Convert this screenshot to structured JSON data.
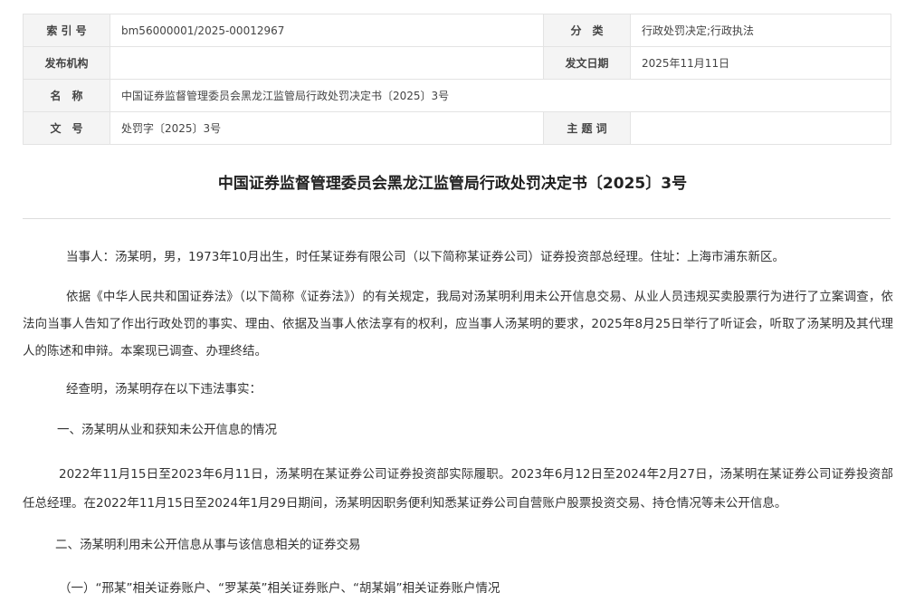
{
  "meta": {
    "index_label": "索 引 号",
    "index_value": "bm56000001/2025-00012967",
    "category_label": "分　类",
    "category_value": "行政处罚决定;行政执法",
    "publisher_label": "发布机构",
    "publisher_value": "",
    "date_label": "发文日期",
    "date_value": "2025年11月11日",
    "name_label": "名　称",
    "name_value": "中国证券监督管理委员会黑龙江监管局行政处罚决定书〔2025〕3号",
    "docno_label": "文　号",
    "docno_value": "处罚字〔2025〕3号",
    "keywords_label": "主 题 词",
    "keywords_value": ""
  },
  "document": {
    "title": "中国证券监督管理委员会黑龙江监管局行政处罚决定书〔2025〕3号",
    "p1": "当事人：汤某明，男，1973年10月出生，时任某证券有限公司（以下简称某证券公司）证券投资部总经理。住址：上海市浦东新区。",
    "p2": "依据《中华人民共和国证券法》（以下简称《证券法》）的有关规定，我局对汤某明利用未公开信息交易、从业人员违规买卖股票行为进行了立案调查，依法向当事人告知了作出行政处罚的事实、理由、依据及当事人依法享有的权利，应当事人汤某明的要求，2025年8月25日举行了听证会，听取了汤某明及其代理人的陈述和申辩。本案现已调查、办理终结。",
    "p3": "经查明，汤某明存在以下违法事实：",
    "p4": "一、汤某明从业和获知未公开信息的情况",
    "p5": "2022年11月15日至2023年6月11日，汤某明在某证券公司证券投资部实际履职。2023年6月12日至2024年2月27日，汤某明在某证券公司证券投资部任总经理。在2022年11月15日至2024年1月29日期间，汤某明因职务便利知悉某证券公司自营账户股票投资交易、持仓情况等未公开信息。",
    "p6": "二、汤某明利用未公开信息从事与该信息相关的证券交易",
    "p7": "（一）“邢某”相关证券账户、“罗某英”相关证券账户、“胡某娟”相关证券账户情况"
  }
}
